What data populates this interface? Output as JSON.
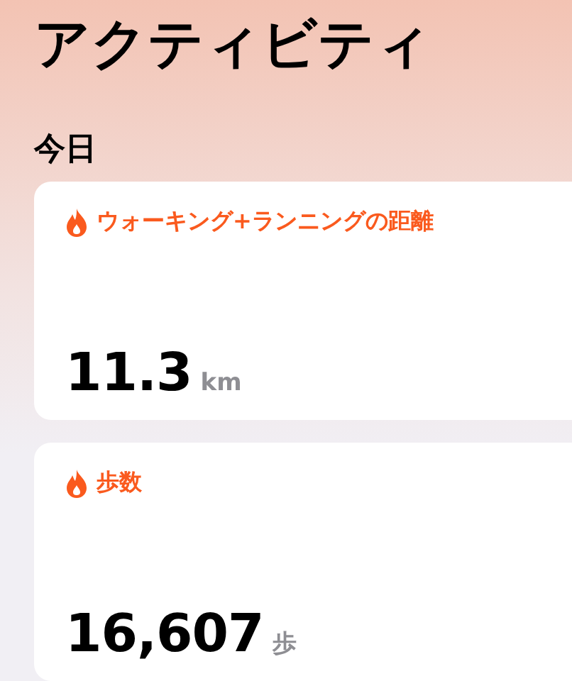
{
  "title": "アクティビティ",
  "section": "今日",
  "cards": [
    {
      "label": "ウォーキング+ランニングの距離",
      "value": "11.3",
      "unit": "km"
    },
    {
      "label": "歩数",
      "value": "16,607",
      "unit": "歩"
    }
  ]
}
